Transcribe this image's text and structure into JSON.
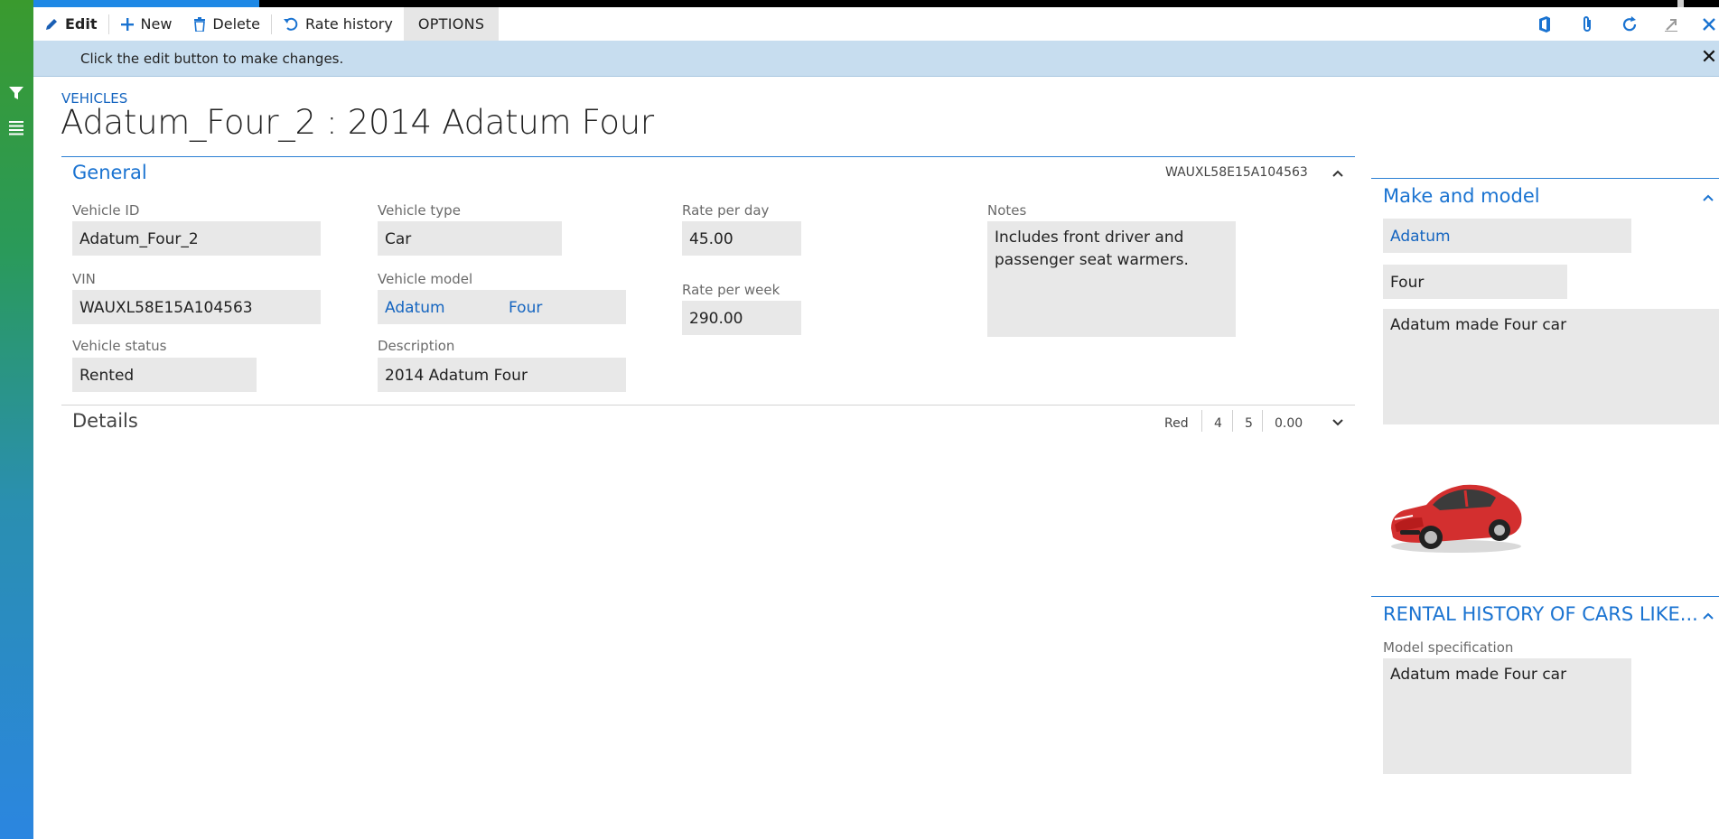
{
  "toolbar": {
    "edit_label": "Edit",
    "new_label": "New",
    "delete_label": "Delete",
    "rate_history_label": "Rate history",
    "options_label": "OPTIONS"
  },
  "infobar": {
    "message": "Click the edit button to make changes.",
    "close_glyph": "✕"
  },
  "page": {
    "breadcrumb": "VEHICLES",
    "title": "Adatum_Four_2 : 2014 Adatum Four"
  },
  "general": {
    "title": "General",
    "summary": "WAUXL58E15A104563",
    "fields": {
      "vehicle_id": {
        "label": "Vehicle ID",
        "value": "Adatum_Four_2"
      },
      "vin": {
        "label": "VIN",
        "value": "WAUXL58E15A104563"
      },
      "vehicle_status": {
        "label": "Vehicle status",
        "value": "Rented"
      },
      "vehicle_type": {
        "label": "Vehicle type",
        "value": "Car"
      },
      "vehicle_model": {
        "label": "Vehicle model",
        "make": "Adatum",
        "model": "Four"
      },
      "description": {
        "label": "Description",
        "value": "2014 Adatum Four"
      },
      "rate_per_day": {
        "label": "Rate per day",
        "value": "45.00"
      },
      "rate_per_week": {
        "label": "Rate per week",
        "value": "290.00"
      },
      "notes": {
        "label": "Notes",
        "value": "Includes front driver and passenger seat warmers."
      }
    }
  },
  "details": {
    "title": "Details",
    "summary": [
      "Red",
      "4",
      "5",
      "0.00"
    ]
  },
  "make_and_model": {
    "title": "Make and model",
    "make": "Adatum",
    "model": "Four",
    "description": "Adatum made Four car"
  },
  "rental_history": {
    "title": "RENTAL HISTORY OF CARS LIKE...",
    "spec_label": "Model specification",
    "spec_value": "Adatum made Four car"
  },
  "icons": {
    "rail": [
      "filter-icon",
      "list-icon"
    ],
    "toolbar": [
      "pencil-icon",
      "plus-icon",
      "trash-icon",
      "undo-icon"
    ],
    "right": [
      "office-icon",
      "paperclip-icon",
      "refresh-icon",
      "popout-icon",
      "close-icon"
    ]
  },
  "colors": {
    "accent": "#1a73d1",
    "infobar": "#c7ddef",
    "field": "#e8e8e8",
    "car": "#d32f2f"
  }
}
